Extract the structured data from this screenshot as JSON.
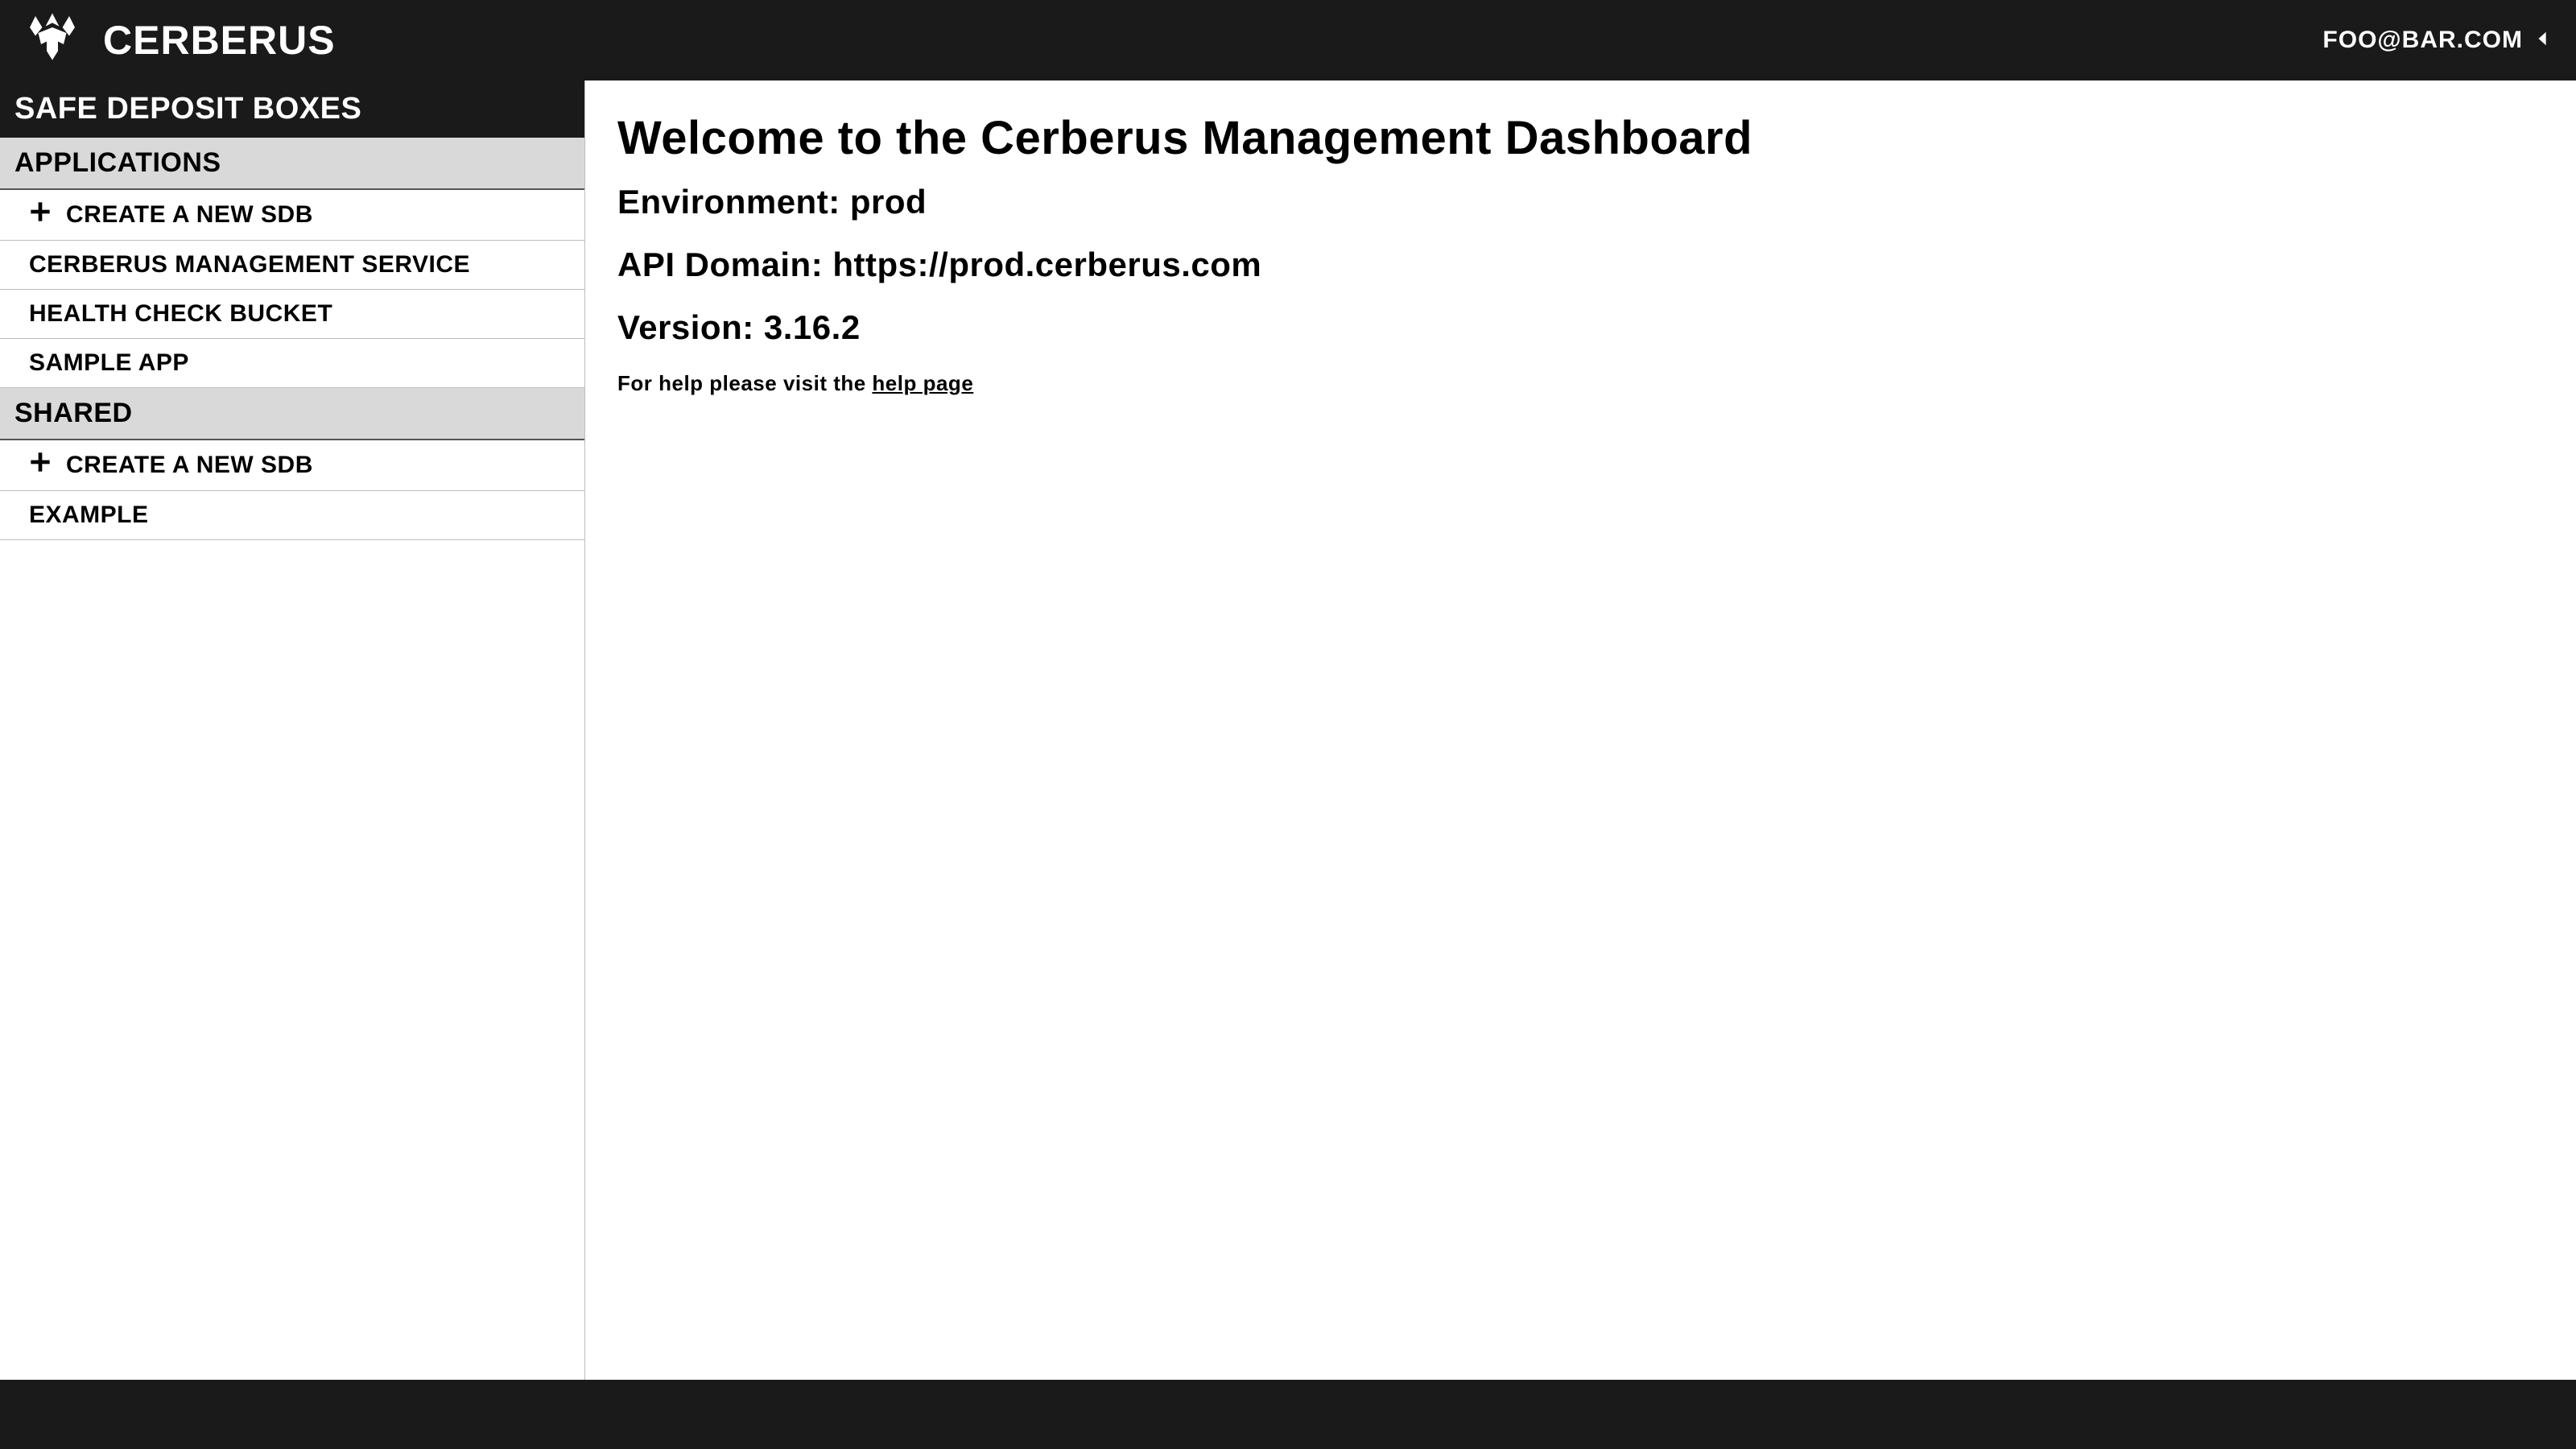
{
  "header": {
    "brand": "CERBERUS",
    "user_email": "FOO@BAR.COM"
  },
  "sidebar": {
    "title": "SAFE DEPOSIT BOXES",
    "sections": [
      {
        "name": "APPLICATIONS",
        "create_label": "CREATE A NEW SDB",
        "items": [
          "CERBERUS MANAGEMENT SERVICE",
          "HEALTH CHECK BUCKET",
          "SAMPLE APP"
        ]
      },
      {
        "name": "SHARED",
        "create_label": "CREATE A NEW SDB",
        "items": [
          "EXAMPLE"
        ]
      }
    ]
  },
  "main": {
    "welcome": "Welcome to the Cerberus Management Dashboard",
    "environment_label": "Environment: ",
    "environment_value": "prod",
    "api_domain_label": "API Domain: ",
    "api_domain_value": "https://prod.cerberus.com",
    "version_label": "Version: ",
    "version_value": "3.16.2",
    "help_prefix": "For help please visit the ",
    "help_link_text": "help page"
  }
}
